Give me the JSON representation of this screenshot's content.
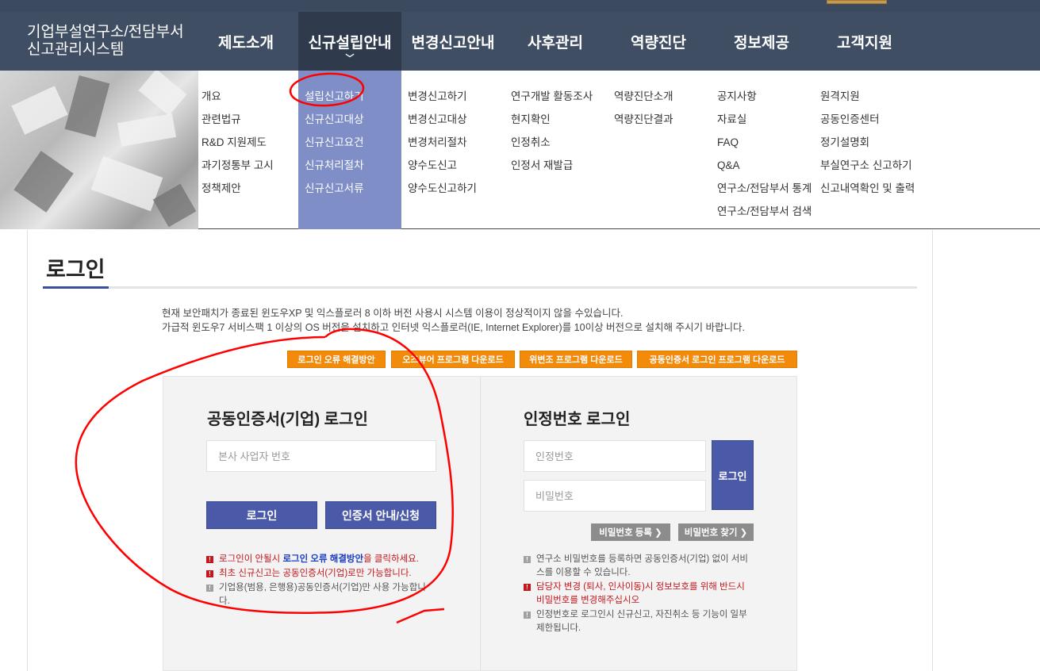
{
  "site": {
    "title_line1": "기업부설연구소/전담부서",
    "title_line2": "신고관리시스템"
  },
  "gnb": [
    {
      "label": "제도소개"
    },
    {
      "label": "신규설립안내"
    },
    {
      "label": "변경신고안내"
    },
    {
      "label": "사후관리"
    },
    {
      "label": "역량진단"
    },
    {
      "label": "정보제공"
    },
    {
      "label": "고객지원"
    }
  ],
  "mega_menu": {
    "col1": [
      "개요",
      "관련법규",
      "R&D 지원제도",
      "과기정통부 고시",
      "정책제안"
    ],
    "col2": [
      "설립신고하기",
      "신규신고대상",
      "신규신고요건",
      "신규처리절차",
      "신규신고서류"
    ],
    "col3": [
      "변경신고하기",
      "변경신고대상",
      "변경처리절차",
      "양수도신고",
      "양수도신고하기"
    ],
    "col4": [
      "연구개발 활동조사",
      "현지확인",
      "인정취소",
      "인정서 재발급"
    ],
    "col5": [
      "역량진단소개",
      "역량진단결과"
    ],
    "col6": [
      "공지사항",
      "자료실",
      "FAQ",
      "Q&A",
      "연구소/전담부서 통계",
      "연구소/전담부서 검색"
    ],
    "col7": [
      "원격지원",
      "공동인증센터",
      "정기설명회",
      "부실연구소 신고하기",
      "신고내역확인 및 출력"
    ]
  },
  "page": {
    "title": "로그인",
    "notice_line1": "현재 보안패치가 종료된 윈도우XP 및 익스플로러 8 이하 버전 사용시 시스템 이용이 정상적이지 않을 수있습니다.",
    "notice_line2": "가급적 윈도우7 서비스팩 1 이상의 OS 버전을 설치하고 인터넷 익스플로러(IE, Internet Explorer)를 10이상 버전으로 설치해 주시기 바랍니다."
  },
  "download_buttons": {
    "btn1": "로그인 오류 해결방안",
    "btn2": "오즈뷰어 프로그램 다운로드",
    "btn3": "위변조 프로그램 다운로드",
    "btn4": "공동인증서 로그인 프로그램 다운로드"
  },
  "cert_login": {
    "title": "공동인증서(기업) 로그인",
    "biz_no_placeholder": "본사 사업자 번호",
    "login_button": "로그인",
    "guide_button": "인증서 안내/신청",
    "info1_pre": "로그인이 안될시 ",
    "info1_link": "로그인 오류 해결방안",
    "info1_post": "을 클릭하세요.",
    "info2": "최초 신규신고는 공동인증서(기업)로만 가능합니다.",
    "info3": "기업용(범용, 은행용)공동인증서(기업)만 사용 가능합니다."
  },
  "pin_login": {
    "title": "인정번호 로그인",
    "id_placeholder": "인정번호",
    "pw_placeholder": "비밀번호",
    "login_button": "로그인",
    "register_pw_button": "비밀번호 등록 ❯",
    "find_pw_button": "비밀번호 찾기 ❯",
    "info1": "연구소 비밀번호를 등록하면 공동인증서(기업) 없이 서비스를 이용할 수 있습니다.",
    "info2": "담당자 변경 (퇴사, 인사이동)시 정보보호를 위해 반드시 비밀번호를 변경해주십시오",
    "info3": "인정번호로 로그인시 신규신고, 자진취소 등 기능이 일부 제한됩니다."
  },
  "colors": {
    "header_bg": "#3f4e62",
    "active_menu_bg": "#7f8ec7",
    "primary_button": "#4a5aa8",
    "orange_button": "#f28a0a",
    "annotation_red": "#ff0000"
  }
}
